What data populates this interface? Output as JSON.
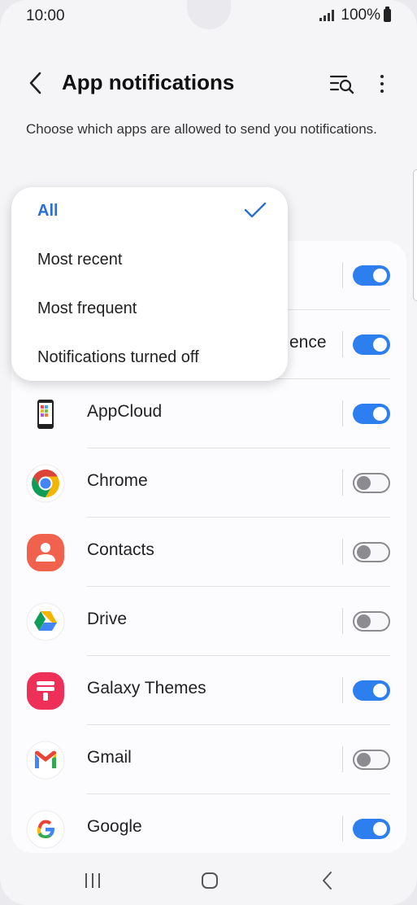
{
  "status": {
    "time": "10:00",
    "battery": "100%"
  },
  "header": {
    "title": "App notifications"
  },
  "description": "Choose which apps are allowed to send you notifications.",
  "dropdown": {
    "options": [
      "All",
      "Most recent",
      "Most frequent",
      "Notifications turned off"
    ],
    "selected": "All"
  },
  "apps": [
    {
      "name": "",
      "enabled": true
    },
    {
      "name": "ence",
      "enabled": true
    },
    {
      "name": "AppCloud",
      "enabled": true,
      "icon": "appcloud-icon"
    },
    {
      "name": "Chrome",
      "enabled": false,
      "icon": "chrome-icon"
    },
    {
      "name": "Contacts",
      "enabled": false,
      "icon": "contacts-icon"
    },
    {
      "name": "Drive",
      "enabled": false,
      "icon": "drive-icon"
    },
    {
      "name": "Galaxy Themes",
      "enabled": true,
      "icon": "galaxy-themes-icon"
    },
    {
      "name": "Gmail",
      "enabled": false,
      "icon": "gmail-icon"
    },
    {
      "name": "Google",
      "enabled": true,
      "icon": "google-icon"
    }
  ],
  "colors": {
    "accent": "#2d7ff0",
    "selected_text": "#2a6fd6"
  }
}
